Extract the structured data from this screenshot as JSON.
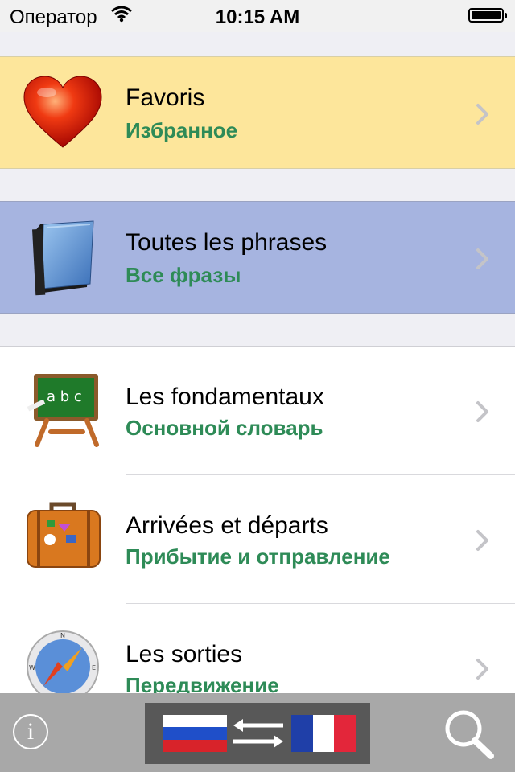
{
  "status_bar": {
    "carrier": "Оператор",
    "time": "10:15 AM"
  },
  "favorites": {
    "title": "Favoris",
    "subtitle": "Избранное",
    "icon": "heart-icon"
  },
  "all_phrases": {
    "title": "Toutes les phrases",
    "subtitle": "Все фразы",
    "icon": "book-icon"
  },
  "categories": [
    {
      "title": "Les fondamentaux",
      "subtitle": "Основной словарь",
      "icon": "chalkboard-icon"
    },
    {
      "title": "Arrivées et départs",
      "subtitle": "Прибытие и отправление",
      "icon": "suitcase-icon"
    },
    {
      "title": "Les sorties",
      "subtitle": "Передвижение",
      "icon": "compass-icon"
    }
  ],
  "toolbar": {
    "info_label": "i",
    "source_language_flag": "russia-flag-icon",
    "target_language_flag": "france-flag-icon"
  },
  "colors": {
    "favorites_bg": "#fde69b",
    "all_phrases_bg": "#a6b4e0",
    "subtitle_green": "#2e8b57",
    "toolbar_bg": "#a8a8a8"
  }
}
